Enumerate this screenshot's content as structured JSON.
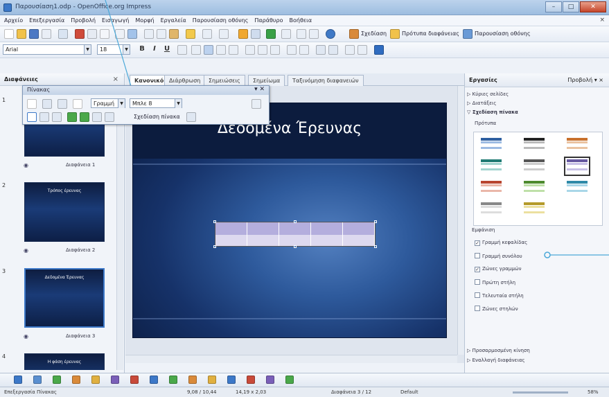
{
  "window": {
    "title": "Παρουσίαση1.odp - OpenOffice.org Impress"
  },
  "menu": [
    "Αρχείο",
    "Επεξεργασία",
    "Προβολή",
    "Εισαγωγή",
    "Μορφή",
    "Εργαλεία",
    "Παρουσίαση οθόνης",
    "Παράθυρο",
    "Βοήθεια"
  ],
  "toolbar": {
    "font_name": "Arial",
    "font_size": "18",
    "btn_design": "Σχεδίαση",
    "btn_templates": "Πρότυπα διαφάνειας",
    "btn_slideshow": "Παρουσίαση οθόνης",
    "bold": "B",
    "italic": "I",
    "underline": "U"
  },
  "slide_pane": {
    "title": "Διαφάνειες",
    "close": "×",
    "slides": [
      {
        "num": "1",
        "label": "Διαφάνεια 1",
        "thumb_title": ""
      },
      {
        "num": "2",
        "label": "Διαφάνεια 2",
        "thumb_title": "Τρόπος έρευνας"
      },
      {
        "num": "3",
        "label": "Διαφάνεια 3",
        "thumb_title": "Δεδομένα Έρευνας"
      },
      {
        "num": "4",
        "label": "",
        "thumb_title": "Η φάση έρευνας"
      }
    ]
  },
  "table_toolbar": {
    "title": "Πίνακας",
    "border_style": "Γραμμή",
    "color": "Μπλε 8",
    "design_label": "Σχεδίαση πίνακα"
  },
  "view_tabs": [
    "Κανονικό",
    "Διάρθρωση",
    "Σημειώσεις",
    "Σημείωμα",
    "Ταξινόμηση διαφανειών"
  ],
  "slide": {
    "title": "Δεδομένα Έρευνας"
  },
  "task_pane": {
    "title": "Εργασίες",
    "view": "Προβολή",
    "sections": [
      "Κύριες σελίδες",
      "Διατάξεις",
      "Σχεδίαση πίνακα"
    ],
    "styles_label": "Πρότυπα",
    "options_label": "Εμφάνιση",
    "options": [
      {
        "label": "Γραμμή κεφαλίδας",
        "checked": true
      },
      {
        "label": "Γραμμή συνόλου",
        "checked": false
      },
      {
        "label": "Ζώνες γραμμών",
        "checked": true
      },
      {
        "label": "Πρώτη στήλη",
        "checked": false
      },
      {
        "label": "Τελευταία στήλη",
        "checked": false
      },
      {
        "label": "Ζώνες στηλών",
        "checked": false
      }
    ],
    "bottom_sections": [
      "Προσαρμοσμένη κίνηση",
      "Εναλλαγή διαφάνειας"
    ]
  },
  "status": {
    "mode": "Επεξεργασία Πίνακας",
    "position": "9,08 / 10,44",
    "size": "14,19 x 2,03",
    "slide": "Διαφάνεια 3 / 12",
    "layout": "Default",
    "zoom": "58%"
  },
  "colors": {
    "accent": "#3c78c8",
    "callout": "#4aa8d8"
  }
}
